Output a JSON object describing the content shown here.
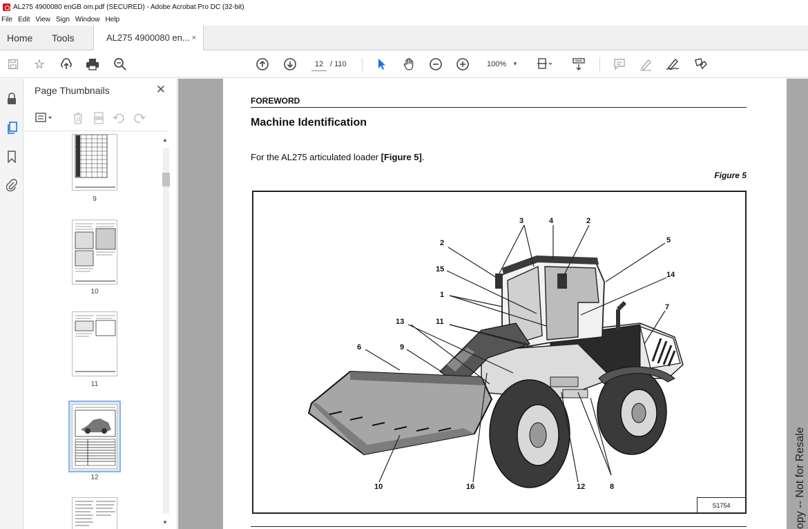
{
  "window": {
    "title": "AL275 4900080 enGB om.pdf (SECURED) - Adobe Acrobat Pro DC (32-bit)"
  },
  "menubar": {
    "items": [
      "File",
      "Edit",
      "View",
      "Sign",
      "Window",
      "Help"
    ]
  },
  "tabs": {
    "home": "Home",
    "tools": "Tools",
    "document": "AL275 4900080 en...",
    "close": "×"
  },
  "toolbar": {
    "page_current": "12",
    "page_total": "/ 110",
    "zoom": "100%"
  },
  "thumbnails_panel": {
    "title": "Page Thumbnails",
    "pages": [
      {
        "label": "9"
      },
      {
        "label": "10"
      },
      {
        "label": "11"
      },
      {
        "label": "12",
        "selected": true
      }
    ]
  },
  "document": {
    "section": "FOREWORD",
    "heading": "Machine Identification",
    "body_text": "For the AL275 articulated loader ",
    "body_ref": "[Figure 5]",
    "body_end": ".",
    "figure_label": "Figure 5",
    "figure_code": "S1754",
    "callouts": [
      "3",
      "4",
      "2",
      "2",
      "5",
      "15",
      "14",
      "1",
      "7",
      "13",
      "11",
      "6",
      "9",
      "10",
      "16",
      "12",
      "8"
    ],
    "watermark": "opy -- Not for Resale"
  },
  "colors": {
    "accent": "#1473e6",
    "app_icon": "#d6121a",
    "doc_background": "#a7a7a7"
  }
}
